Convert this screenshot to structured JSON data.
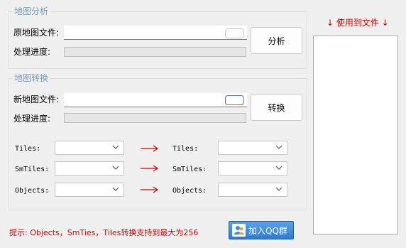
{
  "analyze_group": {
    "title": "地图分析",
    "source_label": "原地图文件:",
    "source_value": "",
    "progress_label": "处理进度:",
    "progress": 0,
    "analyze_button": "分析"
  },
  "convert_group": {
    "title": "地图转换",
    "new_label": "新地图文件:",
    "new_value": "",
    "progress_label": "处理进度:",
    "progress": 0,
    "convert_button": "转换",
    "rows": [
      {
        "left_label": "Tiles:",
        "right_label": "Tiles:"
      },
      {
        "left_label": "SmTiles:",
        "right_label": "SmTiles:"
      },
      {
        "left_label": "Objects:",
        "right_label": "Objects:"
      }
    ]
  },
  "used_files_label": "↓ 使用到文件 ↓",
  "hint": "提示: Objects，SmTies，Tiles转换支持到最大为256",
  "qq_button": "加入QQ群",
  "colors": {
    "group_title": "#7a98b8",
    "accent_red": "#d40000",
    "qq_blue": "#2d7bd2"
  }
}
